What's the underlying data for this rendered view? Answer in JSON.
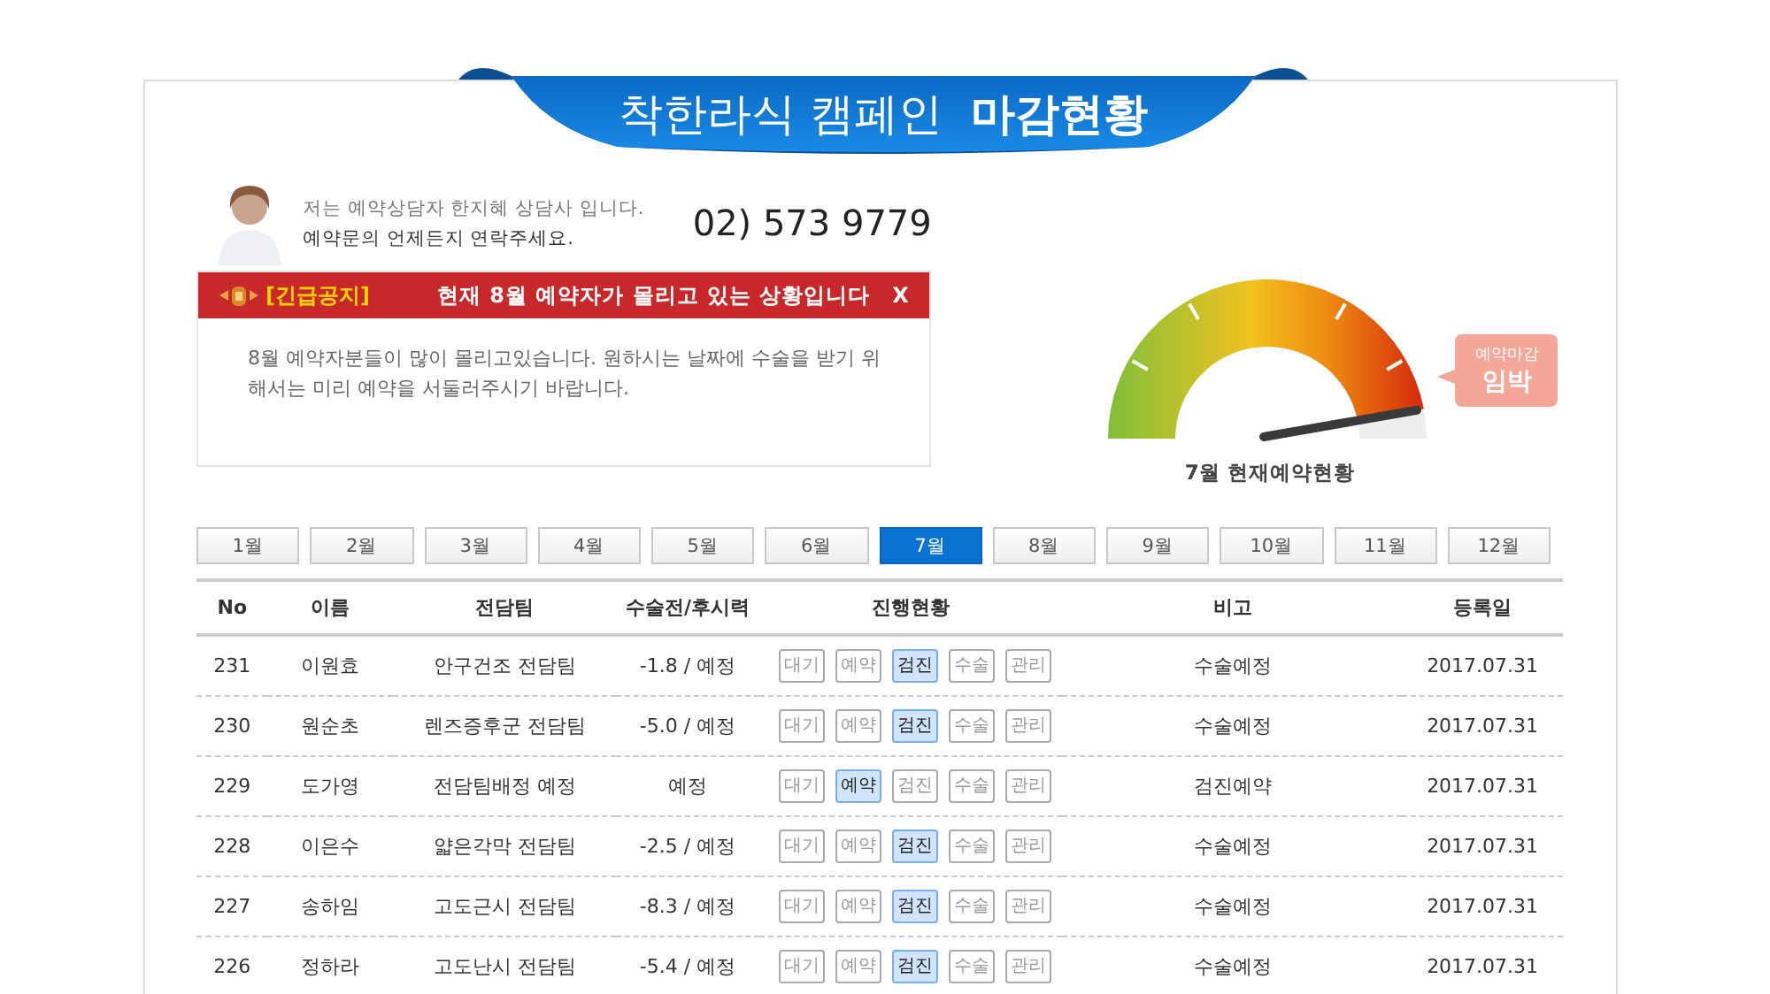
{
  "banner": {
    "title": "착한라식 캠페인  **마감현황**"
  },
  "consultant": {
    "intro": "저는 예약상담자 한지혜 상담사 입니다.",
    "note": "예약문의 언제든지 연락주세요.",
    "phone": "02) 573 9779"
  },
  "notice": {
    "tag": "[긴급공지]",
    "headline": "현재 8월 예약자가 몰리고 있는 상황입니다",
    "close": "X",
    "body": "8월 예약자분들이 많이 몰리고있습니다. 원하시는 날짜에 수술을 받기 위해서는 미리 예약을 서둘러주시기 바랍니다."
  },
  "gauge": {
    "level": 0.94,
    "bubble_top": "예약마감",
    "bubble_main": "임박",
    "caption": "7월 현재예약현황"
  },
  "months": [
    {
      "label": "1월",
      "selected": false
    },
    {
      "label": "2월",
      "selected": false
    },
    {
      "label": "3월",
      "selected": false
    },
    {
      "label": "4월",
      "selected": false
    },
    {
      "label": "5월",
      "selected": false
    },
    {
      "label": "6월",
      "selected": false
    },
    {
      "label": "7월",
      "selected": true
    },
    {
      "label": "8월",
      "selected": false
    },
    {
      "label": "9월",
      "selected": false
    },
    {
      "label": "10월",
      "selected": false
    },
    {
      "label": "11월",
      "selected": false
    },
    {
      "label": "12월",
      "selected": false
    }
  ],
  "table": {
    "columns": [
      "No",
      "이름",
      "전담팀",
      "수술전/후시력",
      "진행현황",
      "비고",
      "등록일"
    ],
    "rows": [
      {
        "no": "231",
        "name": "이원효",
        "team": "안구건조 전담팀",
        "vision": "-1.8 / 예정",
        "stages": [
          {
            "label": "대기",
            "selected": false
          },
          {
            "label": "예약",
            "selected": false
          },
          {
            "label": "검진",
            "selected": true
          },
          {
            "label": "수술",
            "selected": false
          },
          {
            "label": "관리",
            "selected": false
          }
        ],
        "note": "수술예정",
        "date": "2017.07.31"
      },
      {
        "no": "230",
        "name": "원순초",
        "team": "렌즈증후군 전담팀",
        "vision": "-5.0 / 예정",
        "stages": [
          {
            "label": "대기",
            "selected": false
          },
          {
            "label": "예약",
            "selected": false
          },
          {
            "label": "검진",
            "selected": true
          },
          {
            "label": "수술",
            "selected": false
          },
          {
            "label": "관리",
            "selected": false
          }
        ],
        "note": "수술예정",
        "date": "2017.07.31"
      },
      {
        "no": "229",
        "name": "도가영",
        "team": "전담팀배정 예정",
        "vision": "예정",
        "stages": [
          {
            "label": "대기",
            "selected": false
          },
          {
            "label": "예약",
            "selected": true
          },
          {
            "label": "검진",
            "selected": false
          },
          {
            "label": "수술",
            "selected": false
          },
          {
            "label": "관리",
            "selected": false
          }
        ],
        "note": "검진예약",
        "date": "2017.07.31"
      },
      {
        "no": "228",
        "name": "이은수",
        "team": "얇은각막 전담팀",
        "vision": "-2.5 / 예정",
        "stages": [
          {
            "label": "대기",
            "selected": false
          },
          {
            "label": "예약",
            "selected": false
          },
          {
            "label": "검진",
            "selected": true
          },
          {
            "label": "수술",
            "selected": false
          },
          {
            "label": "관리",
            "selected": false
          }
        ],
        "note": "수술예정",
        "date": "2017.07.31"
      },
      {
        "no": "227",
        "name": "송하임",
        "team": "고도근시 전담팀",
        "vision": "-8.3 / 예정",
        "stages": [
          {
            "label": "대기",
            "selected": false
          },
          {
            "label": "예약",
            "selected": false
          },
          {
            "label": "검진",
            "selected": true
          },
          {
            "label": "수술",
            "selected": false
          },
          {
            "label": "관리",
            "selected": false
          }
        ],
        "note": "수술예정",
        "date": "2017.07.31"
      },
      {
        "no": "226",
        "name": "정하라",
        "team": "고도난시 전담팀",
        "vision": "-5.4 / 예정",
        "stages": [
          {
            "label": "대기",
            "selected": false
          },
          {
            "label": "예약",
            "selected": false
          },
          {
            "label": "검진",
            "selected": true
          },
          {
            "label": "수술",
            "selected": false
          },
          {
            "label": "관리",
            "selected": false
          }
        ],
        "note": "수술예정",
        "date": "2017.07.31"
      }
    ]
  }
}
